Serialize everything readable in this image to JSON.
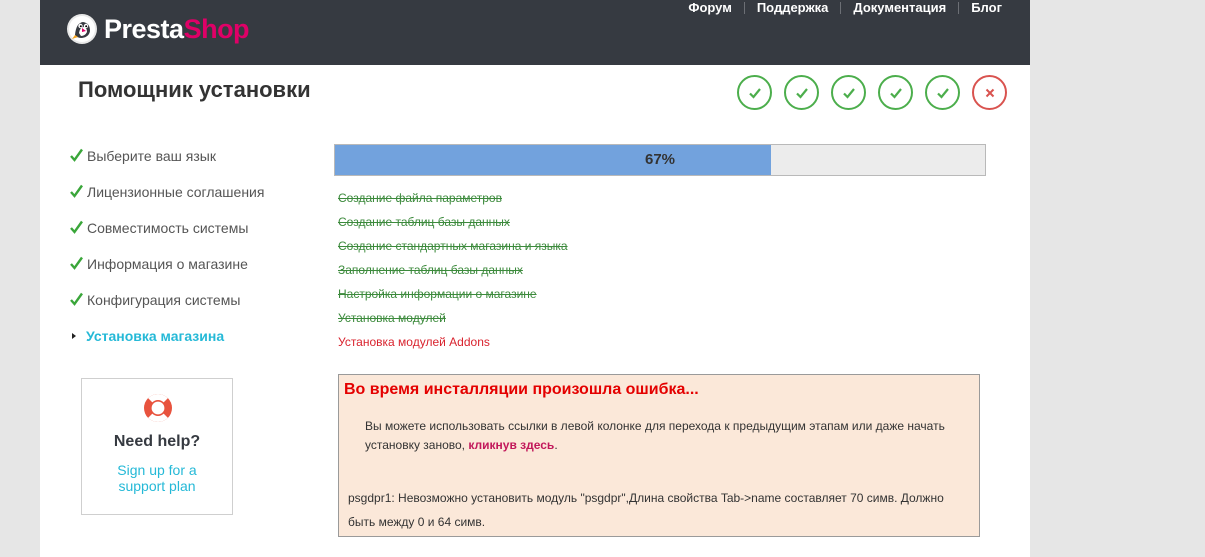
{
  "header": {
    "logo": {
      "presta": "Presta",
      "shop": "Shop",
      "icon": "prestashop-puffin-icon"
    },
    "nav": [
      "Форум",
      "Поддержка",
      "Документация",
      "Блог"
    ]
  },
  "title": "Помощник установки",
  "steps": [
    {
      "status": "done",
      "icon": "check-icon"
    },
    {
      "status": "done",
      "icon": "check-icon"
    },
    {
      "status": "done",
      "icon": "check-icon"
    },
    {
      "status": "done",
      "icon": "check-icon"
    },
    {
      "status": "done",
      "icon": "check-icon"
    },
    {
      "status": "error",
      "icon": "close-icon"
    }
  ],
  "sidebar": {
    "items": [
      {
        "label": "Выберите ваш язык",
        "state": "done"
      },
      {
        "label": "Лицензионные соглашения",
        "state": "done"
      },
      {
        "label": "Совместимость системы",
        "state": "done"
      },
      {
        "label": "Информация о магазине",
        "state": "done"
      },
      {
        "label": "Конфигурация системы",
        "state": "done"
      },
      {
        "label": "Установка магазина",
        "state": "current"
      }
    ]
  },
  "help": {
    "title": "Need help?",
    "link": "Sign up for a support plan",
    "icon": "lifebuoy-icon"
  },
  "progress": {
    "value": 0.67,
    "label": "67%"
  },
  "tasks": [
    {
      "label": "Создание файла параметров",
      "state": "done"
    },
    {
      "label": "Создание таблиц базы данных",
      "state": "done"
    },
    {
      "label": "Создание стандартных магазина и языка",
      "state": "done"
    },
    {
      "label": "Заполнение таблиц базы данных",
      "state": "done"
    },
    {
      "label": "Настройка информации о магазине",
      "state": "done"
    },
    {
      "label": "Установка модулей",
      "state": "done"
    },
    {
      "label": "Установка модулей Addons",
      "state": "error"
    }
  ],
  "error": {
    "title": "Во время инсталляции произошла ошибка...",
    "message_before": "Вы можете использовать ссылки в левой колонке для перехода к предыдущим этапам или даже начать установку заново, ",
    "message_link": "кликнув здесь",
    "message_after": ".",
    "detail": "psgdpr1: Невозможно установить модуль \"psgdpr\",Длина свойства Tab->name составляет 70 симв. Должно быть между 0 и 64 симв."
  },
  "colors": {
    "header_bg": "#363a41",
    "brand_pink": "#df0067",
    "accent_blue": "#25b9d7",
    "success_green": "#4cae4c",
    "error_red": "#d9534f",
    "progress_fill": "#72a2dd",
    "error_box_bg": "#fbe8d9"
  }
}
